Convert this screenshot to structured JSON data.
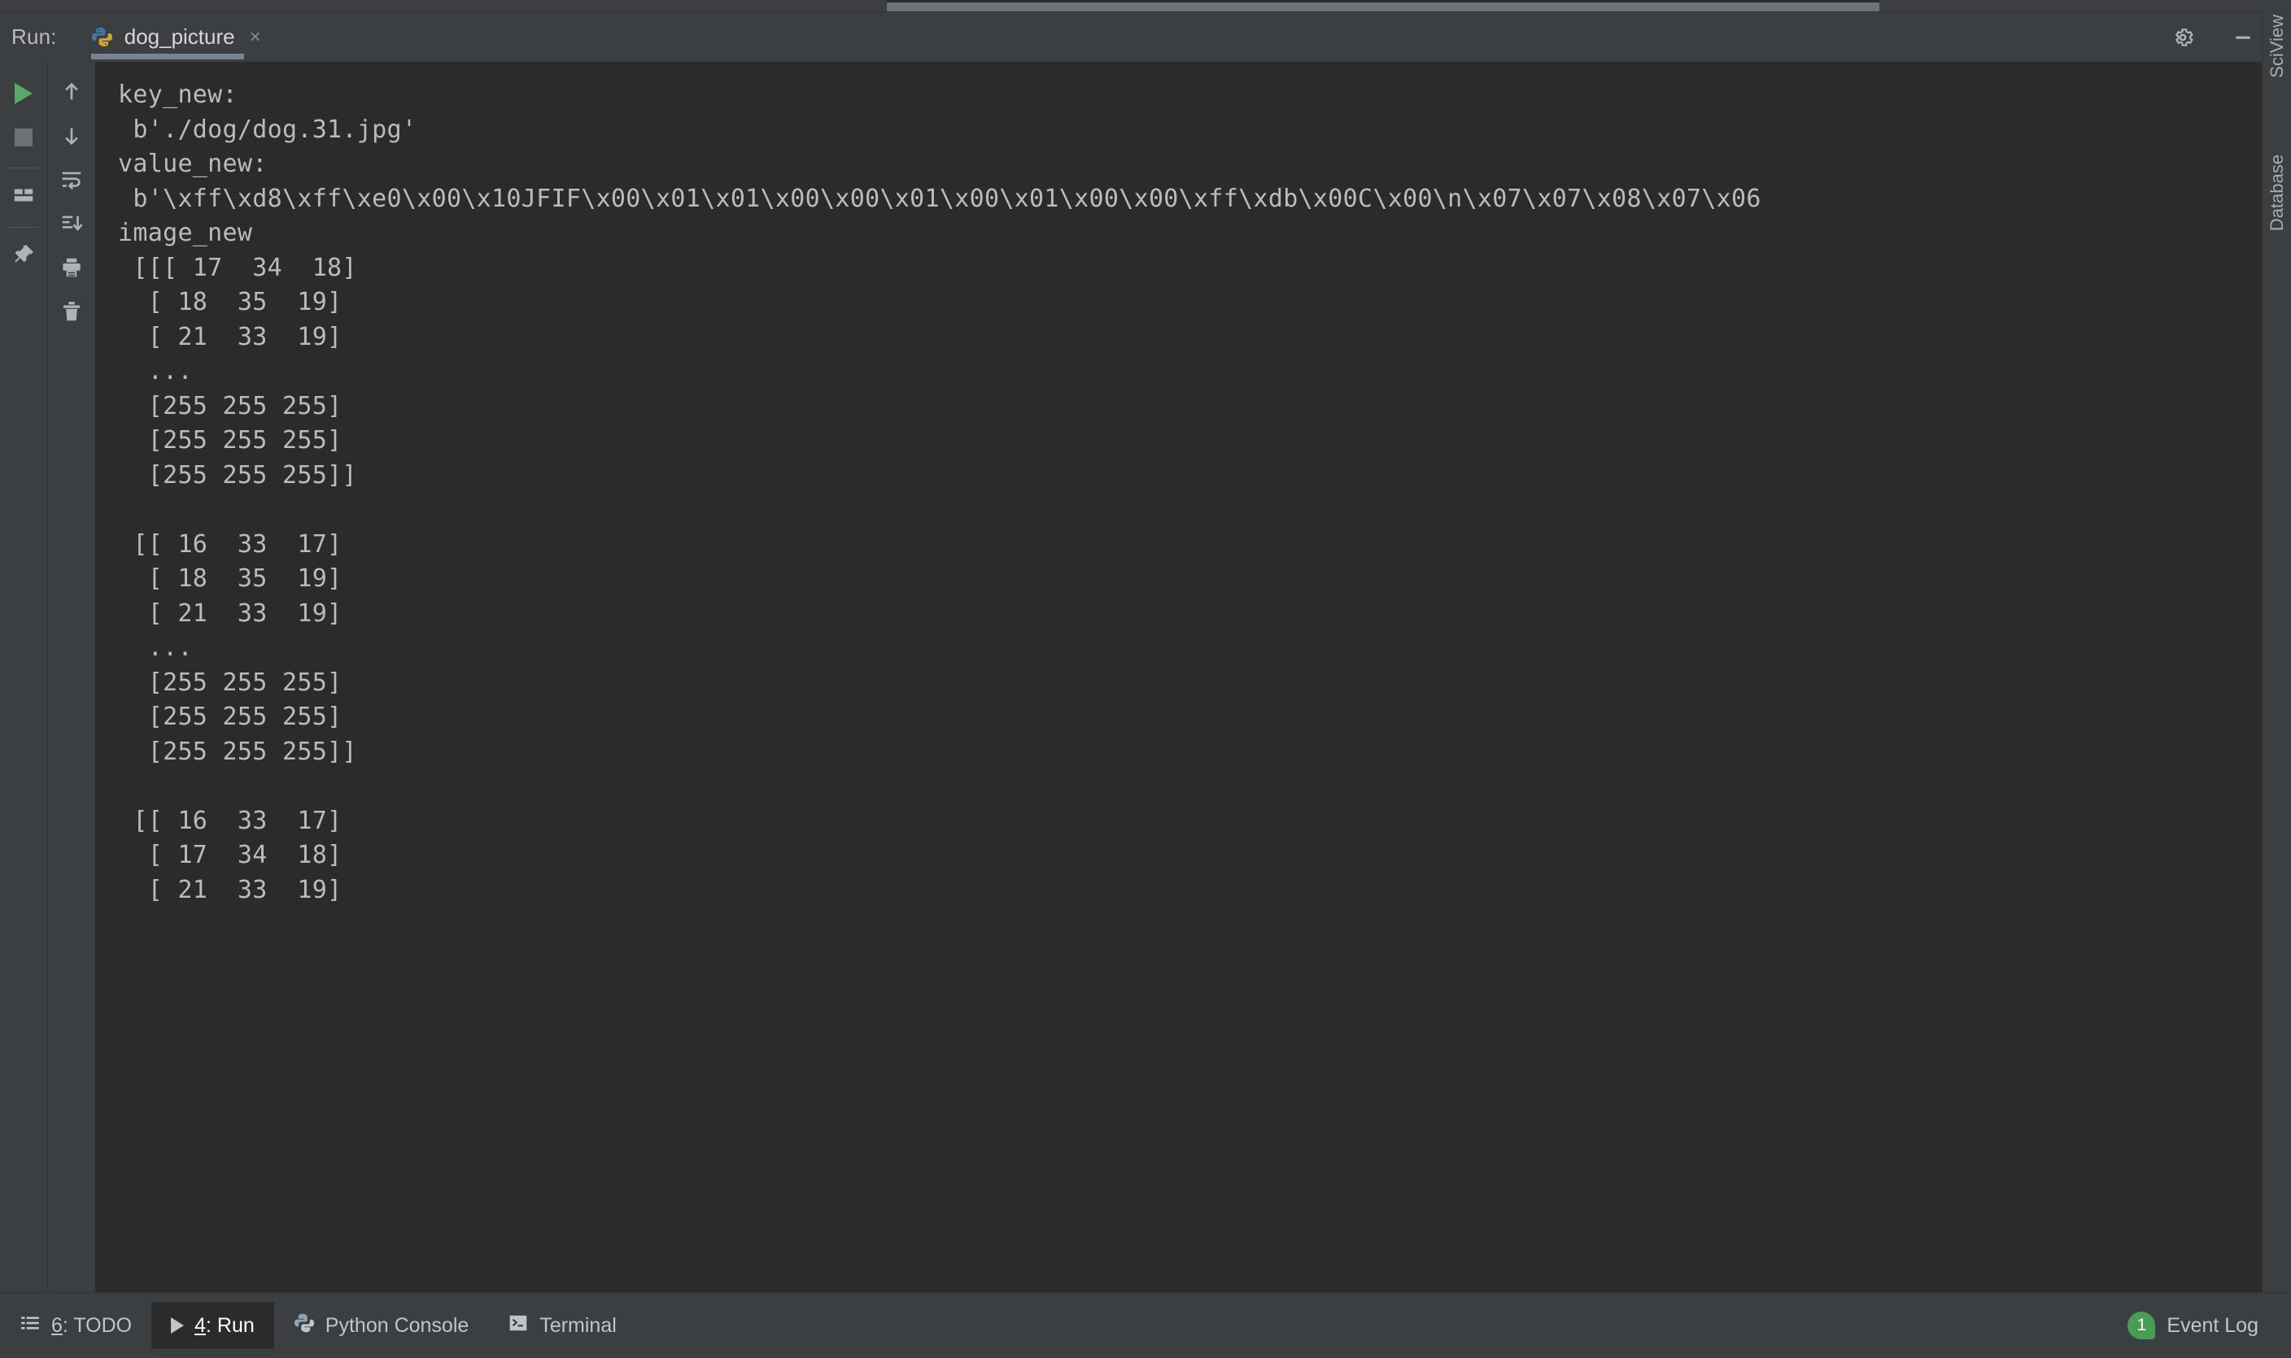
{
  "window": {
    "run_label": "Run:",
    "tab": {
      "title": "dog_picture",
      "icon": "python-icon",
      "close": "×"
    },
    "header_actions": [
      {
        "name": "settings-gear",
        "label": "gear-icon"
      },
      {
        "name": "minimize",
        "label": "minimize-icon"
      }
    ]
  },
  "left_toolbar": {
    "primary": [
      {
        "name": "rerun-button",
        "icon": "play-triangle-icon",
        "tooltip": "Rerun"
      },
      {
        "name": "stop-button",
        "icon": "stop-square-icon",
        "tooltip": "Stop"
      },
      {
        "name": "layout-button",
        "icon": "layout-grid-icon",
        "tooltip": "Layout"
      },
      {
        "name": "pin-button",
        "icon": "pin-icon",
        "tooltip": "Pin Tab"
      }
    ],
    "secondary": [
      {
        "name": "prev-occurrence-button",
        "icon": "arrow-up-icon",
        "tooltip": "Up the Stack Trace"
      },
      {
        "name": "next-occurrence-button",
        "icon": "arrow-down-icon",
        "tooltip": "Down the Stack Trace"
      },
      {
        "name": "soft-wrap-button",
        "icon": "soft-wrap-icon",
        "tooltip": "Soft-Wrap"
      },
      {
        "name": "scroll-to-end-button",
        "icon": "scroll-to-end-icon",
        "tooltip": "Scroll to the end"
      },
      {
        "name": "print-button",
        "icon": "printer-icon",
        "tooltip": "Print"
      },
      {
        "name": "clear-all-button",
        "icon": "trash-icon",
        "tooltip": "Clear All"
      }
    ]
  },
  "console": {
    "lines": [
      "key_new:",
      " b'./dog/dog.31.jpg'",
      "value_new:",
      " b'\\xff\\xd8\\xff\\xe0\\x00\\x10JFIF\\x00\\x01\\x01\\x00\\x00\\x01\\x00\\x01\\x00\\x00\\xff\\xdb\\x00C\\x00\\n\\x07\\x07\\x08\\x07\\x06",
      "image_new",
      " [[[ 17  34  18]",
      "  [ 18  35  19]",
      "  [ 21  33  19]",
      "  ...",
      "  [255 255 255]",
      "  [255 255 255]",
      "  [255 255 255]]",
      "",
      " [[ 16  33  17]",
      "  [ 18  35  19]",
      "  [ 21  33  19]",
      "  ...",
      "  [255 255 255]",
      "  [255 255 255]",
      "  [255 255 255]]",
      "",
      " [[ 16  33  17]",
      "  [ 17  34  18]",
      "  [ 21  33  19]"
    ]
  },
  "right_strip": {
    "tabs": [
      {
        "name": "sciview-tool-tab",
        "label": "SciView"
      },
      {
        "name": "database-tool-tab",
        "label": "Database"
      }
    ]
  },
  "status_bar": {
    "items": [
      {
        "name": "statusbar-todo",
        "number": "6",
        "label": ": TODO",
        "icon": "list-icon",
        "active": false
      },
      {
        "name": "statusbar-run",
        "number": "4",
        "label": ": Run",
        "icon": "play-triangle-icon",
        "active": true
      },
      {
        "name": "statusbar-python-console",
        "number": "",
        "label": "Python Console",
        "icon": "python-icon",
        "active": false
      },
      {
        "name": "statusbar-terminal",
        "number": "",
        "label": "Terminal",
        "icon": "terminal-icon",
        "active": false
      }
    ],
    "event_log": {
      "count": "1",
      "label": "Event Log"
    }
  },
  "colors": {
    "panel_bg": "#3c3f41",
    "console_bg": "#2b2b2b",
    "text": "#bbbbbb",
    "accent_green": "#59a869",
    "badge_green": "#499c54",
    "tab_underline": "#7a8491"
  }
}
